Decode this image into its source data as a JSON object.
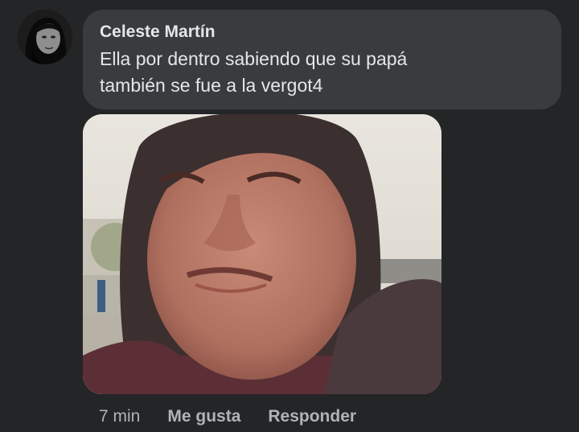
{
  "comment": {
    "author": "Celeste Martín",
    "text_lines": [
      "Ella por dentro sabiendo que su papá",
      "también se fue a la vergot4"
    ],
    "timestamp": "7 min",
    "actions": {
      "like": "Me gusta",
      "reply": "Responder"
    },
    "avatar_icon": "profile-photo",
    "attachment_icon": "attached-photo"
  },
  "colors": {
    "background": "#242526",
    "bubble": "#3a3b3c",
    "primary_text": "#e4e6eb",
    "secondary_text": "#b0b3b8"
  }
}
